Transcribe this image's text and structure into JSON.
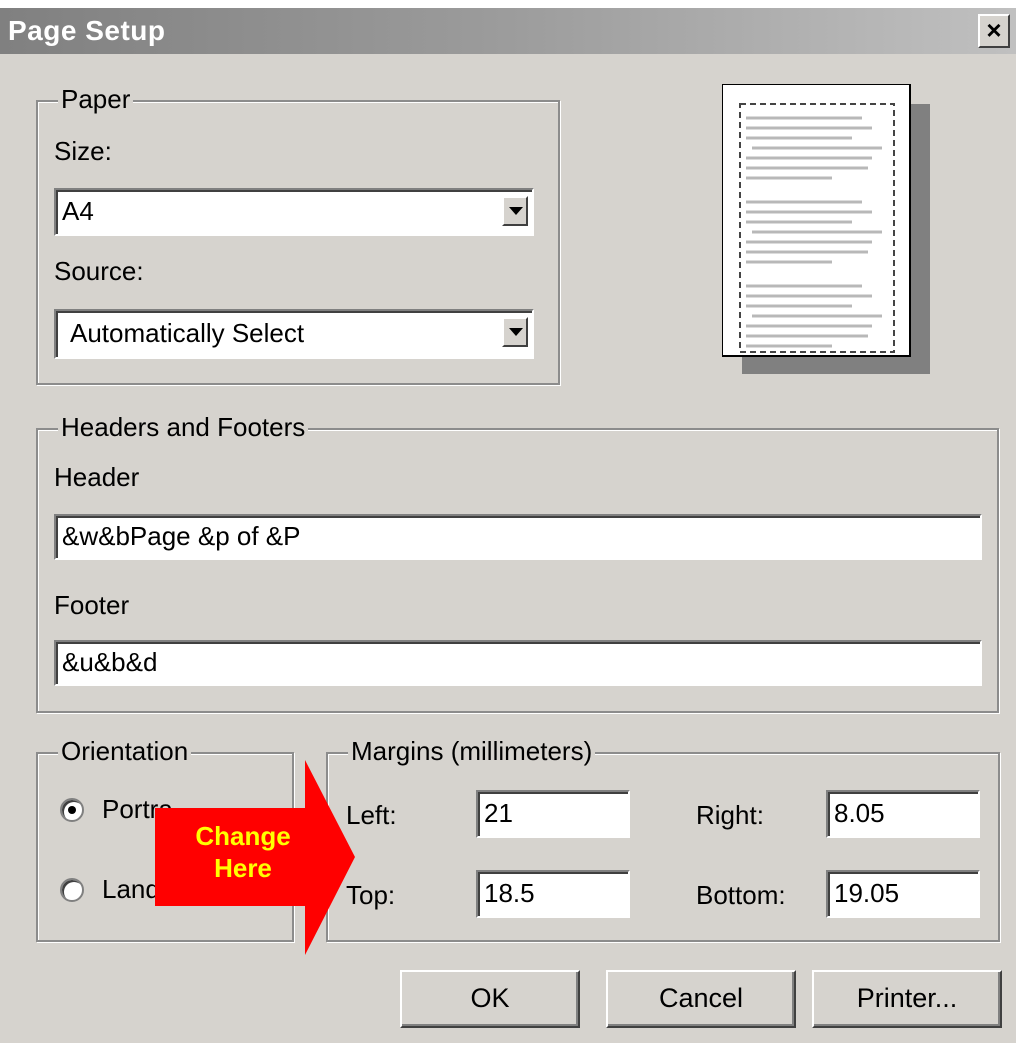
{
  "window": {
    "title": "Page Setup",
    "close_glyph": "×"
  },
  "paper": {
    "legend": "Paper",
    "size_label": "Size:",
    "size_value": "A4",
    "source_label": "Source:",
    "source_value": "Automatically Select"
  },
  "headers_footers": {
    "legend": "Headers and Footers",
    "header_label": "Header",
    "header_value": "&w&bPage &p of &P",
    "footer_label": "Footer",
    "footer_value": "&u&b&d"
  },
  "orientation": {
    "legend": "Orientation",
    "portrait_label": "Portra",
    "landscape_label": "Land",
    "selected": "portrait"
  },
  "margins": {
    "legend": "Margins (millimeters)",
    "left_label": "Left:",
    "left_value": "21",
    "right_label": "Right:",
    "right_value": "8.05",
    "top_label": "Top:",
    "top_value": "18.5",
    "bottom_label": "Bottom:",
    "bottom_value": "19.05"
  },
  "buttons": {
    "ok": "OK",
    "cancel": "Cancel",
    "printer": "Printer..."
  },
  "callout": {
    "line1": "Change",
    "line2": "Here",
    "fill_color": "#ff0000",
    "text_color": "#ffff00"
  }
}
